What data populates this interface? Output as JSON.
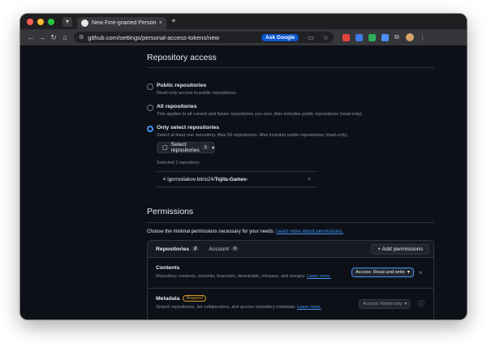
{
  "browser": {
    "tab_title": "New Fine-grained Personal A",
    "tab_close": "×",
    "new_tab": "+",
    "url": "github.com/settings/personal-access-tokens/new",
    "ask_google": "Ask Google",
    "icons": [
      "chevron-down-icon",
      "github-icon",
      "back-icon",
      "forward-icon",
      "reload-icon",
      "home-icon",
      "site-settings-icon",
      "cast-icon",
      "star-icon",
      "extension-icons",
      "puzzle-icon",
      "avatar"
    ]
  },
  "repo_access": {
    "heading": "Repository access",
    "options": [
      {
        "title": "Public repositories",
        "desc": "Read-only access to public repositories."
      },
      {
        "title": "All repositories",
        "desc": "This applies to all current and future repositories you own. Also includes public repositories (read-only)."
      },
      {
        "title": "Only select repositories",
        "desc": "Select at least one repository. Max 50 repositories. Also includes public repositories (read-only)."
      }
    ],
    "selected_option": "Only select repositories",
    "select_button": "Select repositories",
    "select_count": "1",
    "selected_summary": "Selected 1 repository.",
    "repo_owner": "igorrosliakov-bitrix24/",
    "repo_name": "Tojita-Games-",
    "remove": "×"
  },
  "permissions": {
    "heading": "Permissions",
    "intro": "Choose the minimal permissions necessary for your needs.",
    "intro_link": "Learn more about permissions.",
    "tabs": [
      {
        "label": "Repositories",
        "count": "2"
      },
      {
        "label": "Account",
        "count": "0"
      }
    ],
    "add_button": "+ Add permissions",
    "rows": [
      {
        "title": "Contents",
        "desc": "Repository contents, commits, branches, downloads, releases, and merges.",
        "link": "Learn more.",
        "access": "Access: Read and write",
        "action": "×"
      },
      {
        "title": "Metadata",
        "badge": "Required",
        "desc": "Search repositories, list collaborators, and access repository metadata.",
        "link": "Learn more.",
        "access": "Access: Read-only",
        "action": "ⓘ"
      }
    ]
  },
  "colors": {
    "accent": "#4493f8",
    "background": "#0d1117",
    "attention": "#d29922"
  }
}
